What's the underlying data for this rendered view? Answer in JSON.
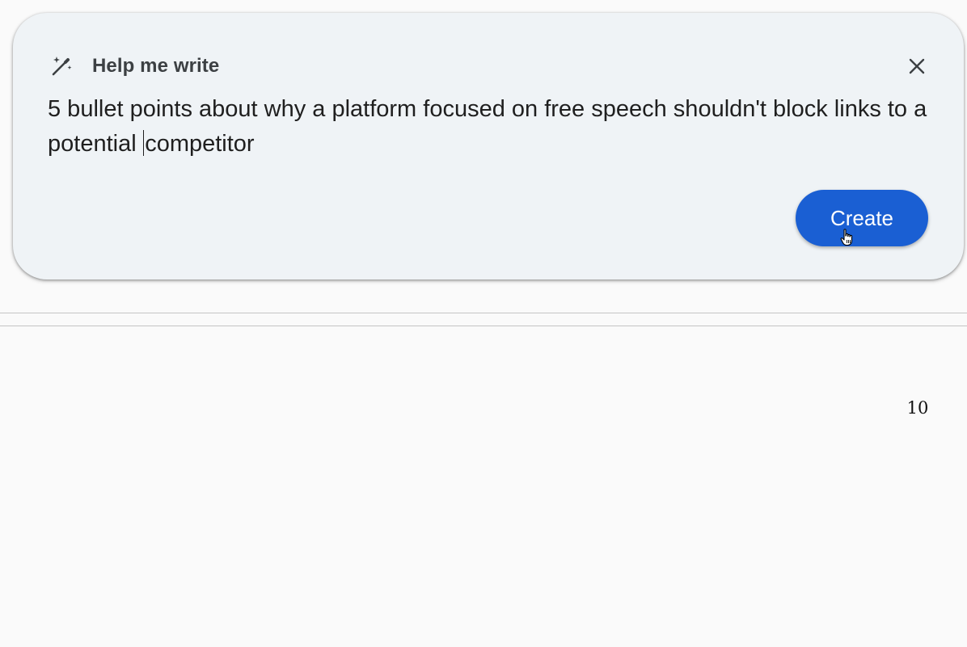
{
  "dialog": {
    "title": "Help me write",
    "title_icon": "magic-wand-icon",
    "close_icon": "close-icon",
    "prompt_before_caret": "5 bullet points about why a platform focused on free speech shouldn't block links to a potential ",
    "prompt_after_caret": "competitor",
    "create_label": "Create"
  },
  "document": {
    "page_number": "10"
  },
  "colors": {
    "dialog_background": "#eff3f6",
    "create_button": "#1a5fd3",
    "page_background": "#fafafa"
  }
}
